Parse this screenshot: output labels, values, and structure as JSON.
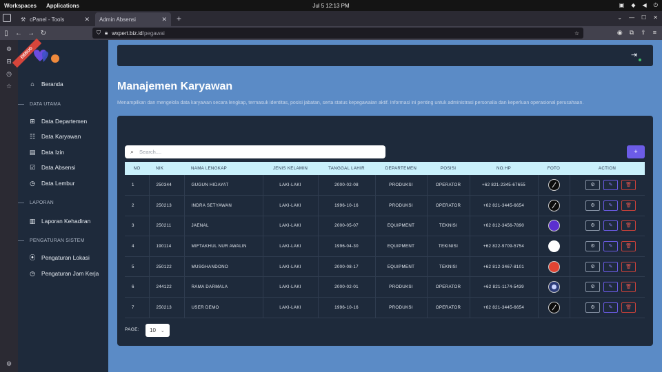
{
  "system": {
    "workspaces": "Workspaces",
    "applications": "Applications",
    "clock": "Jul 5  12:13 PM"
  },
  "browser": {
    "tabs": [
      {
        "label": "cPanel - Tools"
      },
      {
        "label": "Admin Absensi"
      }
    ],
    "url_host": "wxpert.biz.id",
    "url_path": "/pegawai"
  },
  "sidebar": {
    "badge": "DEBUG",
    "items": {
      "beranda": "Beranda",
      "departemen": "Data Departemen",
      "karyawan": "Data Karyawan",
      "izin": "Data Izin",
      "absensi": "Data Absensi",
      "lembur": "Data Lembur",
      "laporan": "Laporan Kehadiran",
      "lokasi": "Pengaturan Lokasi",
      "jamkerja": "Pengaturan Jam Kerja"
    },
    "sections": {
      "data": "DATA UTAMA",
      "laporan": "LAPORAN",
      "pengaturan": "PENGATURAN SISTEM"
    }
  },
  "page": {
    "title": "Manajemen Karyawan",
    "description": "Menampilkan dan mengelola data karyawan secara lengkap, termasuk identitas, posisi jabatan, serta status kepegawaian aktif. Informasi ini penting untuk administrasi personalia dan keperluan operasional perusahaan.",
    "search_placeholder": "Search....",
    "add_label": "+"
  },
  "table": {
    "headers": [
      "NO",
      "NIK",
      "NAMA LENGKAP",
      "JENIS KELAMIN",
      "TANGGAL LAHIR",
      "DEPARTEMEN",
      "POSISI",
      "NO.HP",
      "FOTO",
      "ACTION"
    ],
    "rows": [
      {
        "no": "1",
        "nik": "250344",
        "nama": "GUGUN HIDAYAT",
        "jk": "LAKI-LAKI",
        "tgl": "2000-02-08",
        "dept": "PRODUKSI",
        "posisi": "OPERATOR",
        "hp": "+62 821-2345-67655"
      },
      {
        "no": "2",
        "nik": "250213",
        "nama": "INDRA SETYAWAN",
        "jk": "LAKI-LAKI",
        "tgl": "1996-10-16",
        "dept": "PRODUKSI",
        "posisi": "OPERATOR",
        "hp": "+62 821-3445-6654"
      },
      {
        "no": "3",
        "nik": "250211",
        "nama": "JAENAL",
        "jk": "LAKI-LAKI",
        "tgl": "2000-05-07",
        "dept": "EQUIPMENT",
        "posisi": "TEKNISI",
        "hp": "+62 812-3456-7890"
      },
      {
        "no": "4",
        "nik": "190114",
        "nama": "MIFTAKHUL NUR AWALIN",
        "jk": "LAKI-LAKI",
        "tgl": "1996-04-30",
        "dept": "EQUIPMENT",
        "posisi": "TEKINISI",
        "hp": "+62 822-9709-5754"
      },
      {
        "no": "5",
        "nik": "250122",
        "nama": "MUSGHANDONO",
        "jk": "LAKI-LAKI",
        "tgl": "2000-08-17",
        "dept": "EQUIPMENT",
        "posisi": "TEKNISI",
        "hp": "+62 812-3467-8101"
      },
      {
        "no": "6",
        "nik": "244122",
        "nama": "RAMA DARMALA",
        "jk": "LAKI-LAKI",
        "tgl": "2000-02-01",
        "dept": "PRODUKSI",
        "posisi": "OPERATOR",
        "hp": "+62 821-1174-5439"
      },
      {
        "no": "7",
        "nik": "250213",
        "nama": "USER DEMO",
        "jk": "LAKI-LAKI",
        "tgl": "1996-10-16",
        "dept": "PRODUKSI",
        "posisi": "OPERATOR",
        "hp": "+62 821-3445-6654"
      }
    ]
  },
  "pager": {
    "label": "PAGE:",
    "value": "10"
  },
  "colors": {
    "sidebar_bg": "#1e2a3b",
    "main_bg": "#5b8bc6",
    "header_row": "#c9f0fb",
    "accent": "#6c5ce7",
    "danger": "#c9413a"
  }
}
